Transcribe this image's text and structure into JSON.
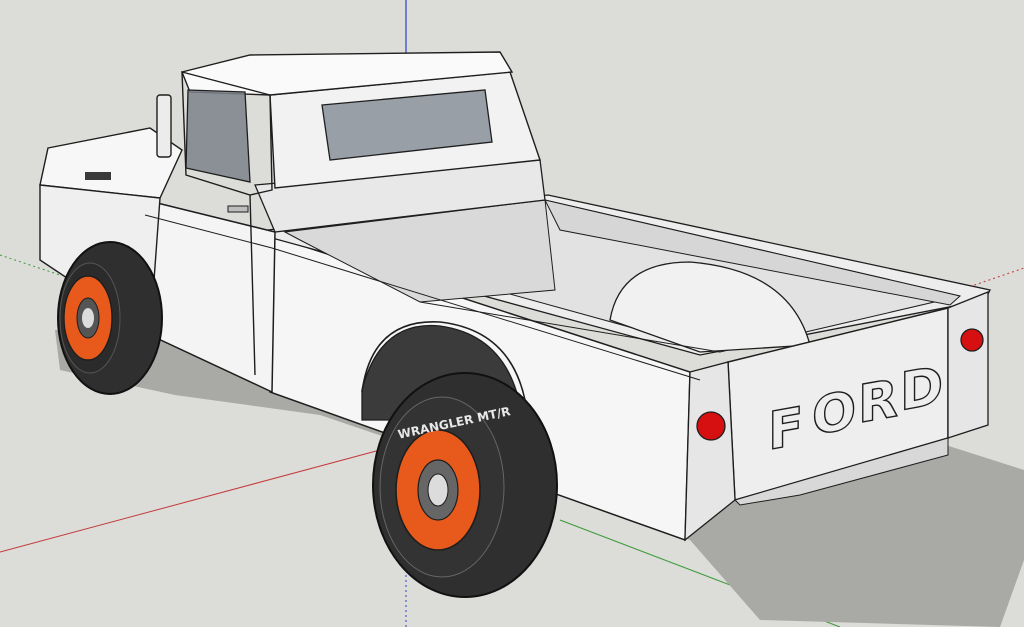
{
  "scene": {
    "background_color": "#dcdcd8",
    "body_color": "#f4f4f4",
    "outline_color": "#1e1e1e",
    "shadow_color": "#a9a9a6",
    "wheel_color": "#e85a1c",
    "tire_color": "#2f2f2f",
    "taillight_color": "#d61010",
    "axis_colors": {
      "red": "#c23b3b",
      "green": "#3a9a3a",
      "blue": "#2b3fc9"
    }
  },
  "truck": {
    "tailgate_text": [
      "F",
      "O",
      "R",
      "D"
    ],
    "tire_sidewall_text": "WRANGLER MT/R",
    "icons": [
      "side-mirror-icon",
      "door-handle-icon",
      "taillight-icon",
      "wheel-icon"
    ]
  }
}
